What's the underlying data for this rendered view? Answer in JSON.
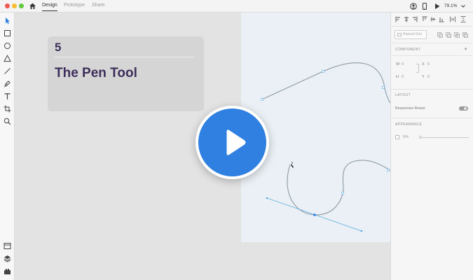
{
  "window": {
    "traffic_lights": [
      "#ee5a52",
      "#f5bd2f",
      "#5fc93f"
    ],
    "tabs": [
      {
        "label": "Design",
        "active": true
      },
      {
        "label": "Prototype",
        "active": false
      },
      {
        "label": "Share",
        "active": false
      }
    ],
    "zoom": "79.1%",
    "toolbar_icons": [
      "user-icon",
      "mobile-preview-icon",
      "play-preview-icon",
      "chevron-down-icon"
    ]
  },
  "tools": [
    "select-icon",
    "rectangle-icon",
    "ellipse-icon",
    "polygon-icon",
    "line-icon",
    "pen-icon",
    "text-icon",
    "artboard-icon",
    "zoom-icon"
  ],
  "bottom_tools": [
    "assets-icon",
    "layers-icon",
    "plugins-icon"
  ],
  "card": {
    "number": "5",
    "title": "The Pen Tool"
  },
  "colors": {
    "accent": "#2f80e0",
    "title": "#3d2f5c",
    "path": "#8e9aa6",
    "handle": "#5aaee0"
  },
  "panel": {
    "repeat_grid_label": "Repeat Grid",
    "component_heading": "COMPONENT",
    "width_label": "W",
    "width_value": "0",
    "height_label": "H",
    "height_value": "0",
    "x_label": "X",
    "x_value": "0",
    "y_label": "Y",
    "y_value": "0",
    "layout_heading": "LAYOUT",
    "responsive_resize_label": "Responsive Resize",
    "appearance_heading": "APPEARANCE",
    "opacity_value": "0%"
  }
}
